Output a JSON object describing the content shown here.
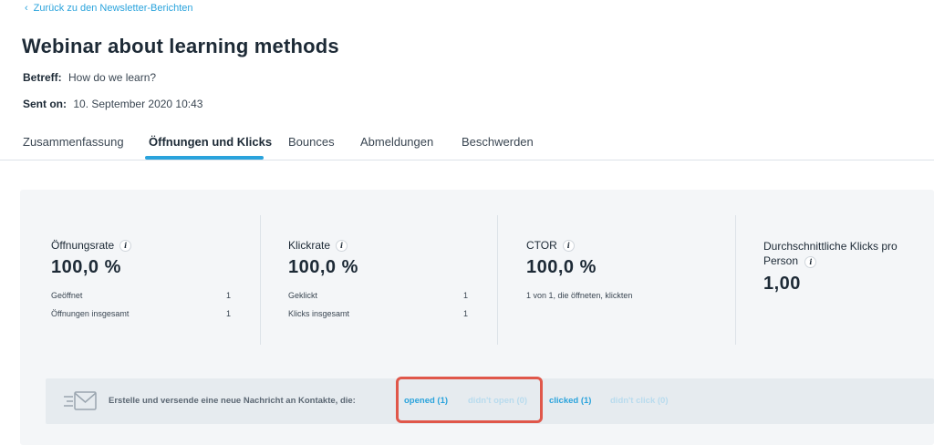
{
  "nav": {
    "back_label": "Zurück zu den Newsletter-Berichten"
  },
  "header": {
    "title": "Webinar about learning methods",
    "subject_label": "Betreff:",
    "subject_value": "How do we learn?",
    "sent_label": "Sent on:",
    "sent_value": "10. September 2020 10:43"
  },
  "tabs": [
    {
      "label": "Zusammenfassung",
      "active": false
    },
    {
      "label": "Öffnungen und Klicks",
      "active": true
    },
    {
      "label": "Bounces",
      "active": false
    },
    {
      "label": "Abmeldungen",
      "active": false
    },
    {
      "label": "Beschwerden",
      "active": false
    }
  ],
  "metrics": {
    "open_rate": {
      "label": "Öffnungsrate",
      "value": "100,0 %",
      "rows": [
        {
          "label": "Geöffnet",
          "value": "1"
        },
        {
          "label": "Öffnungen insgesamt",
          "value": "1"
        }
      ]
    },
    "click_rate": {
      "label": "Klickrate",
      "value": "100,0 %",
      "rows": [
        {
          "label": "Geklickt",
          "value": "1"
        },
        {
          "label": "Klicks insgesamt",
          "value": "1"
        }
      ]
    },
    "ctor": {
      "label": "CTOR",
      "value": "100,0 %",
      "description": "1 von 1, die öffneten, klickten"
    },
    "avg_clicks": {
      "label_line1": "Durchschnittliche Klicks pro",
      "label_line2": "Person",
      "value": "1,00"
    }
  },
  "cta": {
    "text": "Erstelle und versende eine neue Nachricht an Kontakte, die:",
    "chips": [
      {
        "label": "opened (1)",
        "enabled": true
      },
      {
        "label": "didn't open (0)",
        "enabled": false
      },
      {
        "label": "clicked (1)",
        "enabled": true
      },
      {
        "label": "didn't click (0)",
        "enabled": false
      }
    ]
  },
  "colors": {
    "accent": "#2aa3dc",
    "highlight": "#e0574a",
    "text_dark": "#1d2a36",
    "panel_bg": "#f4f6f8"
  }
}
